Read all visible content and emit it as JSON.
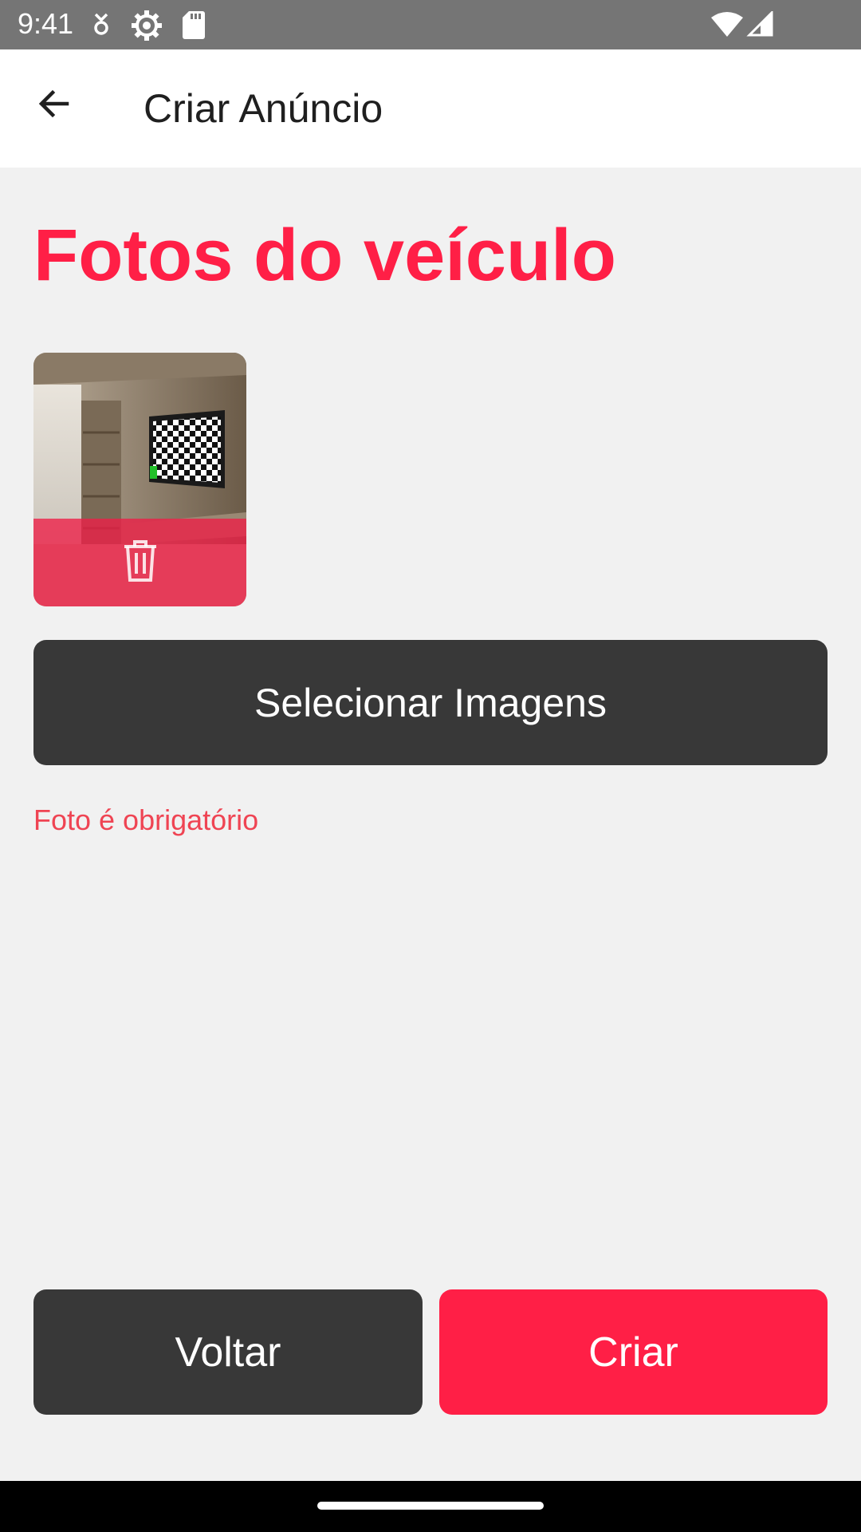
{
  "status_bar": {
    "time": "9:41",
    "icons": [
      "notification-icon",
      "settings-gear-icon",
      "sd-card-icon",
      "wifi-icon",
      "signal-icon"
    ]
  },
  "app_bar": {
    "back_icon": "arrow-back-icon",
    "title": "Criar Anúncio"
  },
  "section": {
    "title": "Fotos do veículo"
  },
  "photos": [
    {
      "thumbnail": "room-with-tv-photo",
      "delete_icon": "trash-icon"
    }
  ],
  "select_button": {
    "label": "Selecionar Imagens"
  },
  "error": {
    "message": "Foto é obrigatório"
  },
  "footer": {
    "back_label": "Voltar",
    "create_label": "Criar"
  },
  "colors": {
    "accent": "#ff1f46",
    "dark_button": "#383838",
    "error_text": "#ef4453",
    "background": "#f1f1f1"
  }
}
